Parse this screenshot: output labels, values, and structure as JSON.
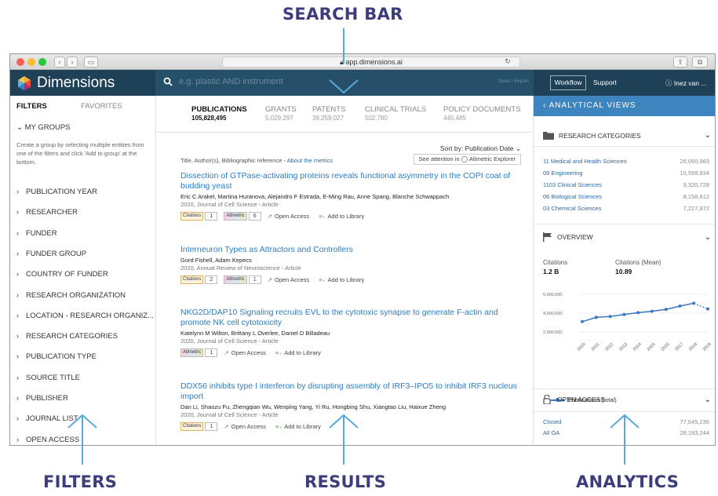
{
  "callouts": {
    "search": "SEARCH BAR",
    "filters": "FILTERS",
    "results": "RESULTS",
    "analytics": "ANALYTICS"
  },
  "browser": {
    "url": "app.dimensions.ai"
  },
  "topnav": {
    "brand": "Dimensions",
    "search_placeholder": "e.g. plastic AND instrument",
    "save_export": "Save / Export",
    "workflow": "Workflow",
    "support": "Support",
    "user": "Inez van ..."
  },
  "sidebar": {
    "tab_filters": "FILTERS",
    "tab_favorites": "FAVORITES",
    "my_groups": "MY GROUPS",
    "help": "Create a group by selecting multiple entities from one of the filters and click 'Add to group' at the bottom.",
    "items": [
      "PUBLICATION YEAR",
      "RESEARCHER",
      "FUNDER",
      "FUNDER GROUP",
      "COUNTRY OF FUNDER",
      "RESEARCH ORGANIZATION",
      "LOCATION - RESEARCH ORGANIZ...",
      "RESEARCH CATEGORIES",
      "PUBLICATION TYPE",
      "SOURCE TITLE",
      "PUBLISHER",
      "JOURNAL LIST",
      "OPEN ACCESS"
    ]
  },
  "results": {
    "tabs": [
      {
        "label": "PUBLICATIONS",
        "count": "105,828,495"
      },
      {
        "label": "GRANTS",
        "count": "5,029,297"
      },
      {
        "label": "PATENTS",
        "count": "39,259,027"
      },
      {
        "label": "CLINICAL TRIALS",
        "count": "502,780"
      },
      {
        "label": "POLICY DOCUMENTS",
        "count": "445,485"
      }
    ],
    "sort_label": "Sort by:",
    "sort_value": "Publication Date",
    "meta_prefix": "Title, Author(s), Bibliographic reference - ",
    "meta_link": "About the metrics",
    "attention": "See attention in",
    "attention_tool": "Altmetric Explorer",
    "citations_label": "Citations",
    "altmetric_label": "Altmetric",
    "open_access": "Open Access",
    "add_library": "Add to Library",
    "items": [
      {
        "title": "Dissection of GTPase-activating proteins reveals functional asymmetry in the COPI coat of budding yeast",
        "authors": "Eric C Arakel, Martina Huranova, Alejandro F Estrada, E-Ming Rau, Anne Spang, Blanche Schwappach",
        "source": "2020, Journal of Cell Science - Article",
        "citations": "1",
        "altmetric": "6"
      },
      {
        "title": "Interneuron Types as Attractors and Controllers",
        "authors": "Gord Fishell, Adam Kepecs",
        "source": "2020, Annual Review of Neuroscience - Article",
        "citations": "2",
        "altmetric": "1"
      },
      {
        "title": "NKG2D/DAP10 Signaling recruits EVL to the cytotoxic synapse to generate F-actin and promote NK cell cytotoxicity",
        "authors": "Katelynn M Wilton, Brittany L Overlee, Daniel D Billadeau",
        "source": "2020, Journal of Cell Science - Article",
        "altmetric": "1"
      },
      {
        "title": "DDX56 inhibits type I interferon by disrupting assembly of IRF3–IPO5 to inhibit IRF3 nucleus import",
        "authors": "Dan Li, Shaozu Fu, Zhengqian Wu, Wenping Yang, Yi Ru, Hongbing Shu, Xiangtao Liu, Haixue Zheng",
        "source": "2020, Journal of Cell Science - Article",
        "citations": "1"
      }
    ]
  },
  "analytics": {
    "header": "ANALYTICAL VIEWS",
    "research_categories": "RESEARCH CATEGORIES",
    "categories": [
      {
        "name": "11 Medical and Health Sciences",
        "value": "26,050,983"
      },
      {
        "name": "09 Engineering",
        "value": "10,599,934"
      },
      {
        "name": "1103 Clinical Sciences",
        "value": "9,320,728"
      },
      {
        "name": "06 Biological Sciences",
        "value": "8,158,612"
      },
      {
        "name": "03 Chemical Sciences",
        "value": "7,227,972"
      }
    ],
    "overview": "OVERVIEW",
    "citations_label": "Citations",
    "citations_value": "1.2 B",
    "citations_mean_label": "Citations (Mean)",
    "citations_mean_value": "10.89",
    "open_access": "OPEN ACCESS",
    "oa_rows": [
      {
        "name": "Closed",
        "value": "77,645,236"
      },
      {
        "name": "All OA",
        "value": "28,183,244"
      }
    ]
  },
  "chart_data": {
    "type": "line",
    "x": [
      "2010",
      "2011",
      "2012",
      "2013",
      "2014",
      "2015",
      "2016",
      "2017",
      "2018",
      "2019"
    ],
    "series": [
      {
        "name": "Publications (total)",
        "values": [
          3100000,
          3550000,
          3650000,
          3850000,
          4050000,
          4200000,
          4400000,
          4750000,
          5050000,
          4450000
        ]
      }
    ],
    "ytick_labels": [
      "6,000,000",
      "4,000,000",
      "2,000,000"
    ],
    "ylim": [
      1500000,
      6500000
    ],
    "color": "#3b78c0",
    "legend": "bottom"
  }
}
